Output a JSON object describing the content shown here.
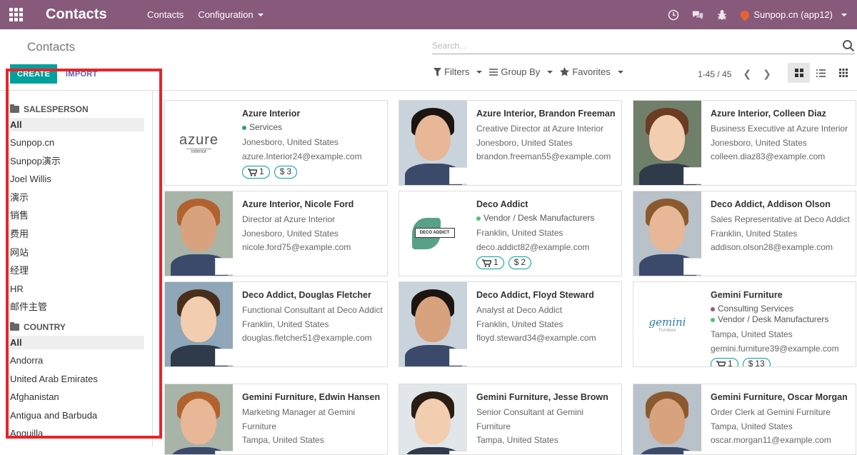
{
  "navbar": {
    "brand": "Contacts",
    "menu": [
      {
        "label": "Contacts",
        "has_caret": false
      },
      {
        "label": "Configuration",
        "has_caret": true
      }
    ],
    "company": "Sunpop.cn (app12)",
    "icons": [
      "clock-icon",
      "chat-icon",
      "bug-icon"
    ]
  },
  "control": {
    "breadcrumb": "Contacts",
    "search_placeholder": "Search...",
    "create_label": "CREATE",
    "import_label": "IMPORT",
    "filters_label": "Filters",
    "groupby_label": "Group By",
    "favorites_label": "Favorites",
    "pager": "1-45 / 45"
  },
  "sidebar": {
    "salesperson": {
      "title": "SALESPERSON",
      "items": [
        "All",
        "Sunpop.cn",
        "Sunpop演示",
        "Joel Willis",
        "演示",
        "销售",
        "费用",
        "网站",
        "经理",
        "HR",
        "邮件主管"
      ]
    },
    "country": {
      "title": "COUNTRY",
      "items": [
        "All",
        "Andorra",
        "United Arab Emirates",
        "Afghanistan",
        "Antigua and Barbuda",
        "Anguilla"
      ]
    }
  },
  "cards": [
    {
      "name": "Azure Interior",
      "tags": [
        {
          "label": "Services",
          "color": "#2e9d8a"
        }
      ],
      "lines": [
        "Jonesboro, United States",
        "azure.Interior24@example.com"
      ],
      "badges": {
        "cart": "1",
        "money": "3"
      },
      "image": "logo-azure"
    },
    {
      "name": "Azure Interior, Brandon Freeman",
      "tags": [],
      "lines": [
        "Creative Director at Azure Interior",
        "Jonesboro, United States",
        "brandon.freeman55@example.com"
      ],
      "image": "portrait"
    },
    {
      "name": "Azure Interior, Colleen Diaz",
      "tags": [],
      "lines": [
        "Business Executive at Azure Interior",
        "Jonesboro, United States",
        "colleen.diaz83@example.com"
      ],
      "image": "portrait"
    },
    {
      "name": "Azure Interior, Nicole Ford",
      "tags": [],
      "lines": [
        "Director at Azure Interior",
        "Jonesboro, United States",
        "nicole.ford75@example.com"
      ],
      "image": "portrait"
    },
    {
      "name": "Deco Addict",
      "tags": [
        {
          "label": "Vendor / Desk Manufacturers",
          "color": "#4fc36a"
        }
      ],
      "lines": [
        "Franklin, United States",
        "deco.addict82@example.com"
      ],
      "badges": {
        "cart": "1",
        "money": "2"
      },
      "image": "logo-deco"
    },
    {
      "name": "Deco Addict, Addison Olson",
      "tags": [],
      "lines": [
        "Sales Representative at Deco Addict",
        "Franklin, United States",
        "addison.olson28@example.com"
      ],
      "image": "portrait"
    },
    {
      "name": "Deco Addict, Douglas Fletcher",
      "tags": [],
      "lines": [
        "Functional Consultant at Deco Addict",
        "Franklin, United States",
        "douglas.fletcher51@example.com"
      ],
      "image": "portrait"
    },
    {
      "name": "Deco Addict, Floyd Steward",
      "tags": [],
      "lines": [
        "Analyst at Deco Addict",
        "Franklin, United States",
        "floyd.steward34@example.com"
      ],
      "image": "portrait"
    },
    {
      "name": "Gemini Furniture",
      "tags": [
        {
          "label": "Consulting Services",
          "color": "#a0577c"
        },
        {
          "label": "Vendor / Desk Manufacturers",
          "color": "#4fc36a"
        }
      ],
      "lines": [
        "Tampa, United States",
        "gemini.furniture39@example.com"
      ],
      "badges": {
        "cart": "1",
        "money": "13"
      },
      "image": "logo-gemini"
    },
    {
      "name": "Gemini Furniture, Edwin Hansen",
      "tags": [],
      "lines": [
        "Marketing Manager at Gemini Furniture",
        "Tampa, United States"
      ],
      "image": "portrait"
    },
    {
      "name": "Gemini Furniture, Jesse Brown",
      "tags": [],
      "lines": [
        "Senior Consultant at Gemini Furniture",
        "Tampa, United States"
      ],
      "image": "portrait"
    },
    {
      "name": "Gemini Furniture, Oscar Morgan",
      "tags": [],
      "lines": [
        "Order Clerk at Gemini Furniture",
        "Tampa, United States",
        "oscar.morgan11@example.com"
      ],
      "image": "portrait"
    }
  ],
  "logos": {
    "azure": "azure",
    "azure_sub": "interior",
    "deco": "DECO ADDICT",
    "gemini": "gemini",
    "gemini_sub": "Furniture"
  }
}
